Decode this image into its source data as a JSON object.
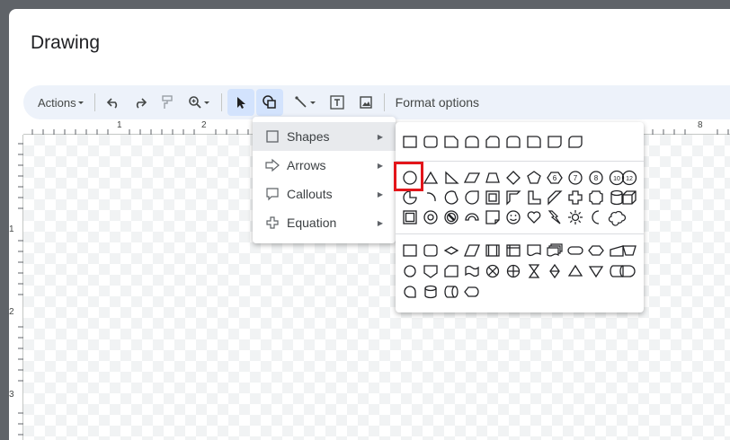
{
  "dialog": {
    "title": "Drawing"
  },
  "toolbar": {
    "actions_label": "Actions",
    "format_options_label": "Format options",
    "icons": [
      "undo-icon",
      "redo-icon",
      "paint-format-icon",
      "zoom-icon",
      "select-icon",
      "shape-icon",
      "line-icon",
      "text-box-icon",
      "image-icon"
    ]
  },
  "ruler": {
    "horizontal": [
      "1",
      "2",
      "8"
    ],
    "vertical": [
      "1",
      "2",
      "3"
    ]
  },
  "shape_menu": {
    "items": [
      {
        "label": "Shapes",
        "icon": "square-icon",
        "selected": true
      },
      {
        "label": "Arrows",
        "icon": "arrow-icon",
        "selected": false
      },
      {
        "label": "Callouts",
        "icon": "callout-icon",
        "selected": false
      },
      {
        "label": "Equation",
        "icon": "plus-icon",
        "selected": false
      }
    ]
  },
  "shapes_panel": {
    "section_labels": [
      "basic-rectangles",
      "shapes",
      "flowchart"
    ],
    "highlighted_shape": "oval",
    "accent": "#e3151a"
  }
}
